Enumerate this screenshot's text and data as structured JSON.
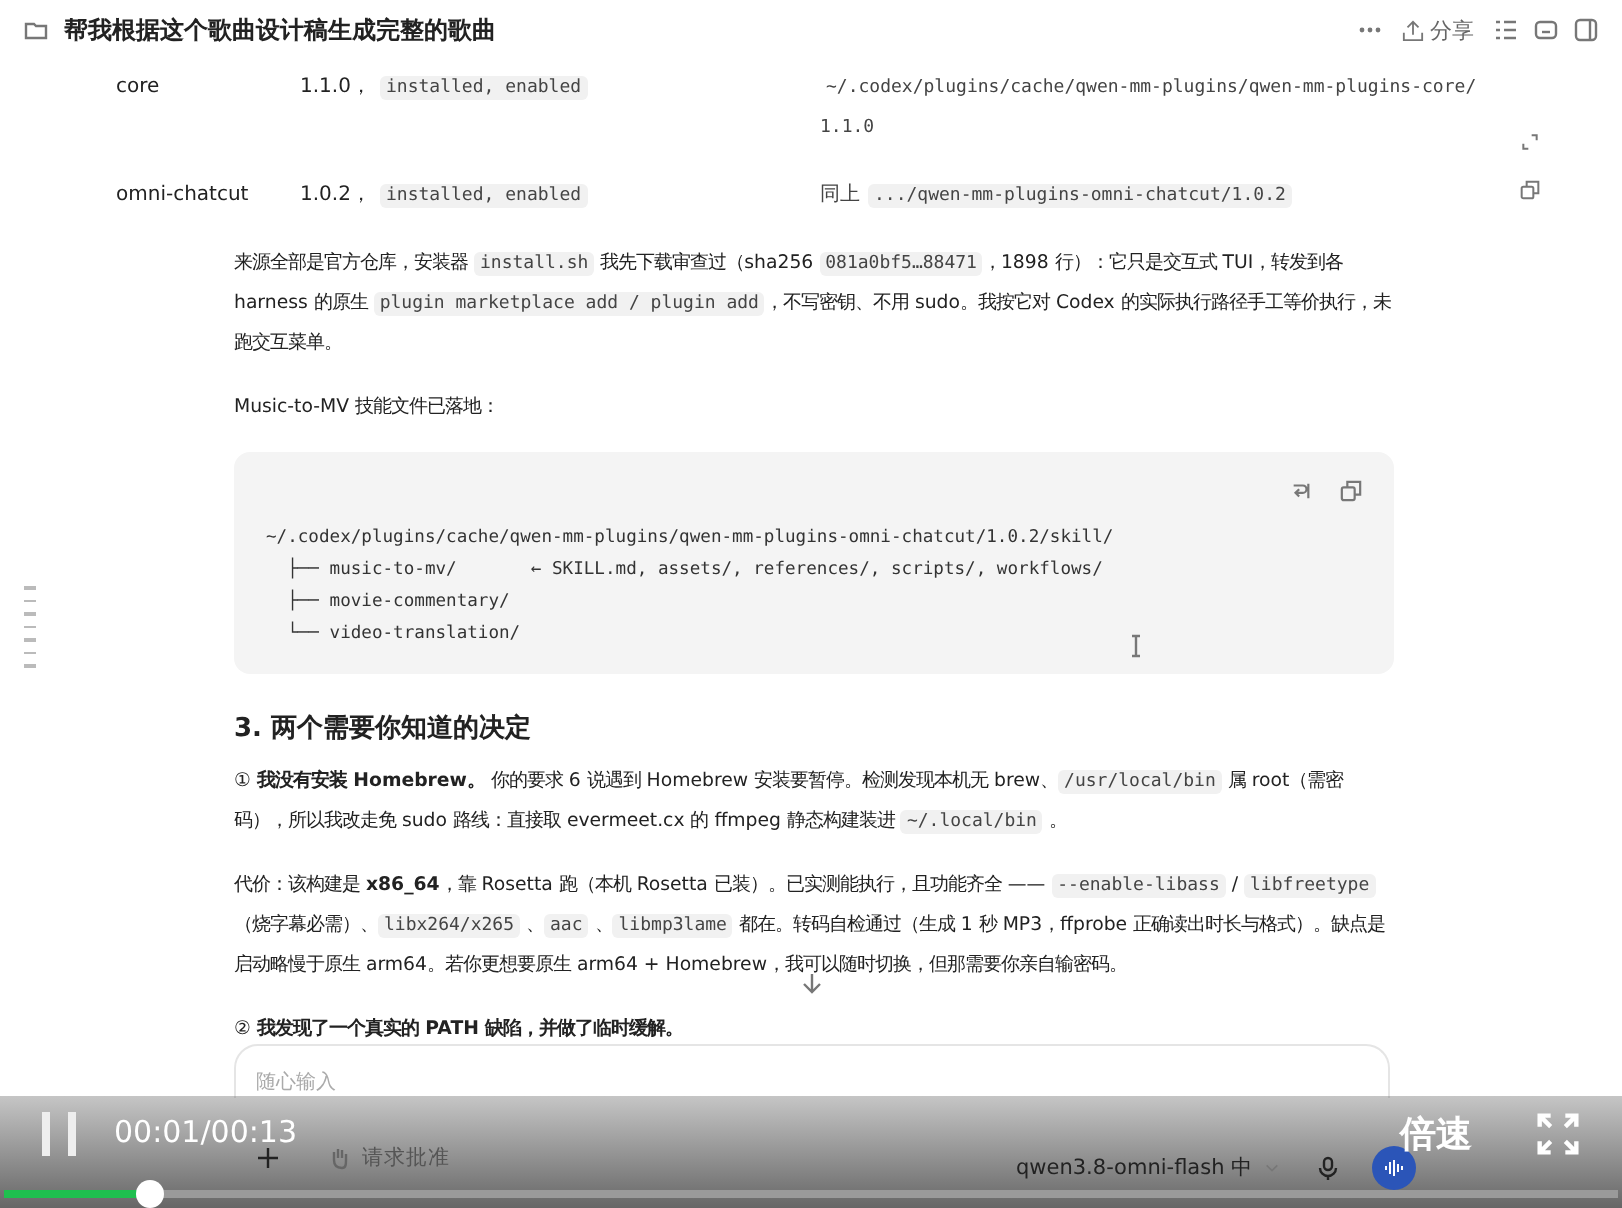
{
  "header": {
    "title": "帮我根据这个歌曲设计稿生成完整的歌曲",
    "share": "分享"
  },
  "plugins": [
    {
      "name": "core",
      "version": "1.1.0，",
      "status": "installed, enabled",
      "path": "~/.codex/plugins/cache/qwen-mm-plugins/qwen-mm-plugins-core/1.1.0"
    },
    {
      "name": "omni-chatcut",
      "version": "1.0.2，",
      "status": "installed, enabled",
      "path_prefix": "同上",
      "path": ".../qwen-mm-plugins-omni-chatcut/1.0.2"
    }
  ],
  "blocks": [
    {
      "kind": "para",
      "segments": [
        {
          "kind": "text",
          "text": "来源全部是官方仓库，安装器 "
        },
        {
          "kind": "code",
          "text": "install.sh"
        },
        {
          "kind": "text",
          "text": " 我先下载审查过（sha256 "
        },
        {
          "kind": "code",
          "text": "081a0bf5…88471"
        },
        {
          "kind": "text",
          "text": "，1898 行）：它只是交互式 TUI，转发到各 harness 的原生 "
        },
        {
          "kind": "code",
          "text": "plugin marketplace add / plugin add"
        },
        {
          "kind": "text",
          "text": "，不写密钥、不用 sudo。我按它对 Codex 的实际执行路径手工等价执行，未跑交互菜单。"
        }
      ]
    },
    {
      "kind": "para",
      "segments": [
        {
          "kind": "text",
          "text": "Music-to-MV 技能文件已落地："
        }
      ]
    },
    {
      "kind": "codeblock",
      "lines": [
        "~/.codex/plugins/cache/qwen-mm-plugins/qwen-mm-plugins-omni-chatcut/1.0.2/skill/",
        "  ├── music-to-mv/       ← SKILL.md, assets/, references/, scripts/, workflows/",
        "  ├── movie-commentary/",
        "  └── video-translation/"
      ]
    },
    {
      "kind": "heading",
      "segments": [
        {
          "kind": "text",
          "text": "3. 两个需要你知道的决定"
        }
      ]
    },
    {
      "kind": "para",
      "segments": [
        {
          "kind": "text",
          "text": "① **我没有安装 Homebrew。** 你的要求 6 说遇到 Homebrew 安装要暂停。检测发现本机无 brew、"
        },
        {
          "kind": "code",
          "text": "/usr/local/bin"
        },
        {
          "kind": "text",
          "text": " 属 root（需密码），所以我改走免 sudo 路线：直接取 evermeet.cx 的 ffmpeg 静态构建装进 "
        },
        {
          "kind": "code",
          "text": "~/.local/bin"
        },
        {
          "kind": "text",
          "text": " 。"
        }
      ]
    },
    {
      "kind": "para",
      "segments": [
        {
          "kind": "text",
          "text": "代价：该构建是 **x86_64**，靠 Rosetta 跑（本机 Rosetta 已装）。已实测能执行，且功能齐全 —— "
        },
        {
          "kind": "code",
          "text": "--enable-libass"
        },
        {
          "kind": "text",
          "text": " / "
        },
        {
          "kind": "code",
          "text": "libfreetype"
        },
        {
          "kind": "text",
          "text": "（烧字幕必需）、"
        },
        {
          "kind": "code",
          "text": "libx264/x265"
        },
        {
          "kind": "text",
          "text": " 、"
        },
        {
          "kind": "code",
          "text": "aac"
        },
        {
          "kind": "text",
          "text": " 、"
        },
        {
          "kind": "code",
          "text": "libmp3lame"
        },
        {
          "kind": "text",
          "text": " 都在。转码自检通过（生成 1 秒 MP3，ffprobe 正确读出时长与格式）。缺点是启动略慢于原生 arm64。若你更想要原生 arm64 + Homebrew，我可以随时切换，但那需要你亲自输密码。"
        }
      ]
    },
    {
      "kind": "para",
      "segments": [
        {
          "kind": "text",
          "text": "② **我发现了一个真实的 PATH 缺陷，并做了临时缓解。**"
        }
      ]
    }
  ],
  "composer": {
    "placeholder": "随心输入",
    "approval": "请求批准",
    "model": "qwen3.8-omni-flash 中"
  },
  "player": {
    "playing": true,
    "time": "00:01/00:13",
    "speed": "倍速",
    "level": 0.09
  }
}
